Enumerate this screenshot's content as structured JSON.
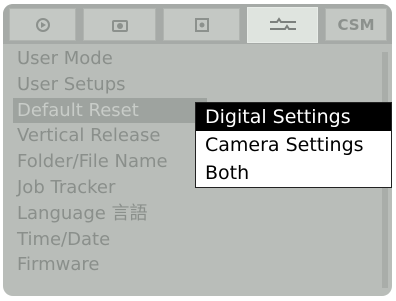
{
  "tabs": [
    {
      "name": "playback-tab",
      "label": "",
      "icon": "playback-icon"
    },
    {
      "name": "shooting-tab",
      "label": "",
      "icon": "camera-icon"
    },
    {
      "name": "display-tab",
      "label": "",
      "icon": "display-icon"
    },
    {
      "name": "setup-tab",
      "label": "",
      "icon": "setup-icon",
      "active": true
    },
    {
      "name": "csm-tab",
      "label": "CSM"
    }
  ],
  "menu": {
    "items": [
      {
        "label": "User Mode"
      },
      {
        "label": "User Setups"
      },
      {
        "label": "Default Reset",
        "selected": true
      },
      {
        "label": "Vertical Release"
      },
      {
        "label": "Folder/File Name"
      },
      {
        "label": "Job Tracker"
      },
      {
        "label": "Language 言語"
      },
      {
        "label": "Time/Date"
      },
      {
        "label": "Firmware"
      }
    ]
  },
  "submenu": {
    "items": [
      {
        "label": "Digital Settings",
        "highlight": true
      },
      {
        "label": "Camera Settings"
      },
      {
        "label": "Both"
      }
    ]
  },
  "colors": {
    "screen_bg": "#b9bdb9",
    "menu_text": "#8a8f8b",
    "selected_row": "#9ea39f",
    "submenu_highlight": "#000000"
  }
}
